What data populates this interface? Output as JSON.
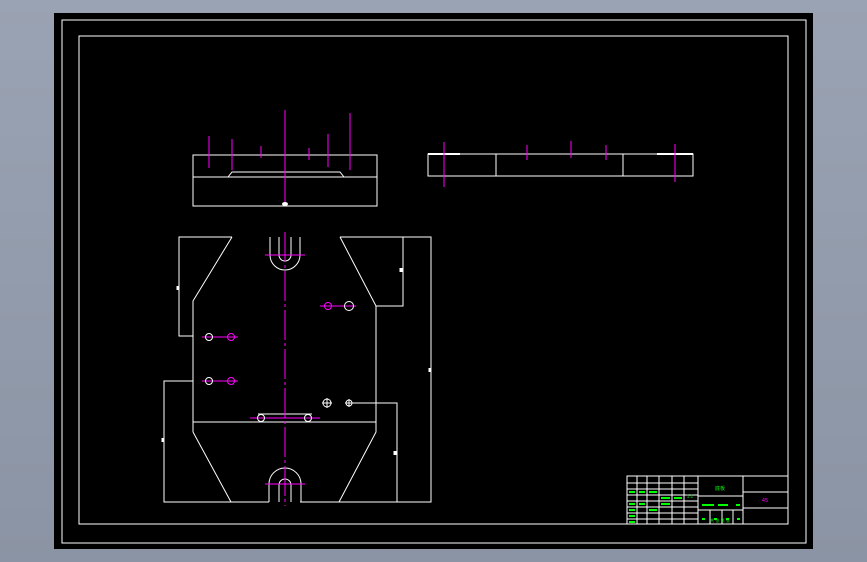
{
  "colors": {
    "background": "#000000",
    "outline": "#ffffff",
    "centerline": "#ff00ff",
    "title_block_text": "#00ff00",
    "title_block_label": "#ff00ff"
  },
  "title_block": {
    "part_name": "底板",
    "drawing_no": "",
    "material": "45",
    "scale": "1:1",
    "sheet": "共 张 第 张"
  }
}
